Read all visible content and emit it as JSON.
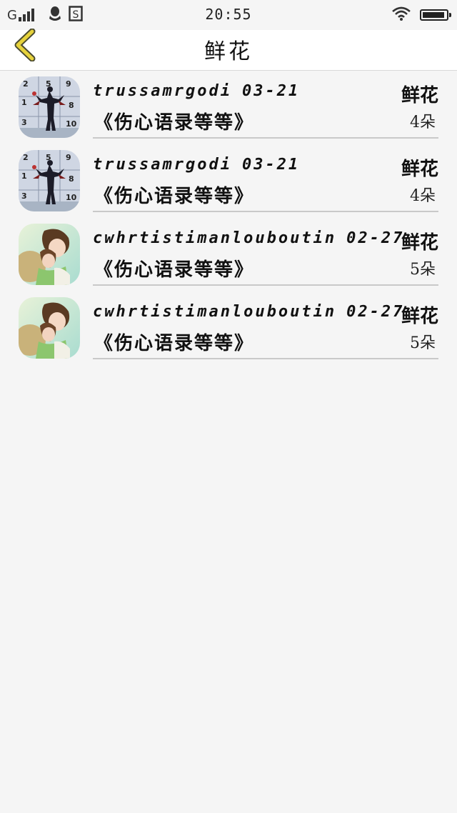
{
  "status_bar": {
    "network_type": "G",
    "time": "20:55",
    "icons": [
      "signal-icon",
      "qq-icon",
      "sim-s-icon",
      "wifi-icon",
      "battery-icon"
    ],
    "battery_level": 0.95
  },
  "header": {
    "title": "鲜花",
    "back_icon": "chevron-left-icon",
    "back_icon_color": "#e6d23c"
  },
  "list": {
    "items": [
      {
        "avatar": "basketball-player-avatar",
        "username": "trussamrgodi",
        "date": "03-21",
        "book": "《伤心语录等等》",
        "gift": "鲜花",
        "count": "4朵"
      },
      {
        "avatar": "basketball-player-avatar",
        "username": "trussamrgodi",
        "date": "03-21",
        "book": "《伤心语录等等》",
        "gift": "鲜花",
        "count": "4朵"
      },
      {
        "avatar": "anime-couple-avatar",
        "username": "cwhrtistimanlouboutin",
        "date": "02-27",
        "book": "《伤心语录等等》",
        "gift": "鲜花",
        "count": "5朵"
      },
      {
        "avatar": "anime-couple-avatar",
        "username": "cwhrtistimanlouboutin",
        "date": "02-27",
        "book": "《伤心语录等等》",
        "gift": "鲜花",
        "count": "5朵"
      }
    ]
  },
  "colors": {
    "background": "#f5f5f5",
    "header_background": "#ffffff",
    "divider": "#c9c9c9"
  }
}
